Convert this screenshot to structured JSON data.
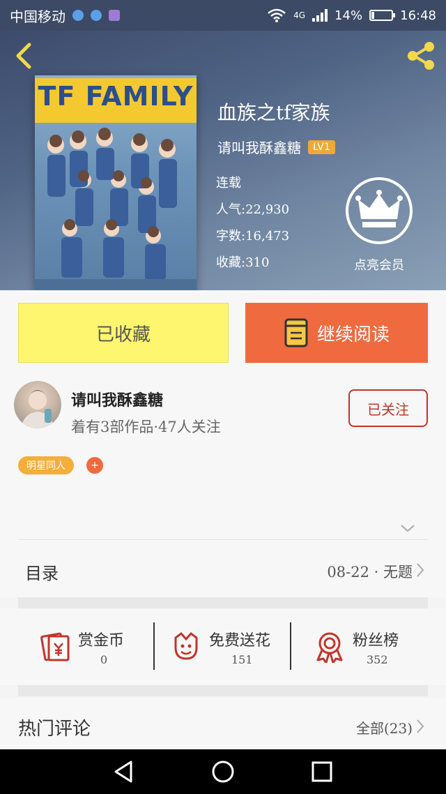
{
  "status_bar": {
    "carrier": "中国移动",
    "network": "4G",
    "battery_text": "14%",
    "battery_level": 0.14,
    "time": "16:48"
  },
  "book": {
    "cover_title": "TF FAMILY",
    "title": "血族之tf家族",
    "author": "请叫我酥鑫糖",
    "author_level": "LV1",
    "status": "连载",
    "popularity": "人气:22,930",
    "word_count": "字数:16,473",
    "collections": "收藏:310",
    "vip_label": "点亮会员"
  },
  "actions": {
    "collected_label": "已收藏",
    "continue_label": "继续阅读"
  },
  "author_card": {
    "name": "请叫我酥鑫糖",
    "subtitle": "着有3部作品·47人关注",
    "follow_label": "已关注",
    "tag": "明星同人",
    "tag_add": "+"
  },
  "catalog": {
    "label": "目录",
    "latest": "08-22 · 无题"
  },
  "stats": [
    {
      "label": "赏金币",
      "value": "0",
      "icon": "red-envelope-icon"
    },
    {
      "label": "免费送花",
      "value": "151",
      "icon": "flower-icon"
    },
    {
      "label": "粉丝榜",
      "value": "352",
      "icon": "medal-icon"
    }
  ],
  "hot_comments": {
    "label": "热门评论",
    "all_label": "全部(23)"
  },
  "colors": {
    "accent_orange": "#ef6a3e",
    "collected_yellow": "#fdf66e",
    "follow_red": "#c2342b",
    "tag_orange": "#f5ad3b",
    "icon_red": "#c2342b",
    "hero_icon_yellow": "#f2d84b"
  }
}
